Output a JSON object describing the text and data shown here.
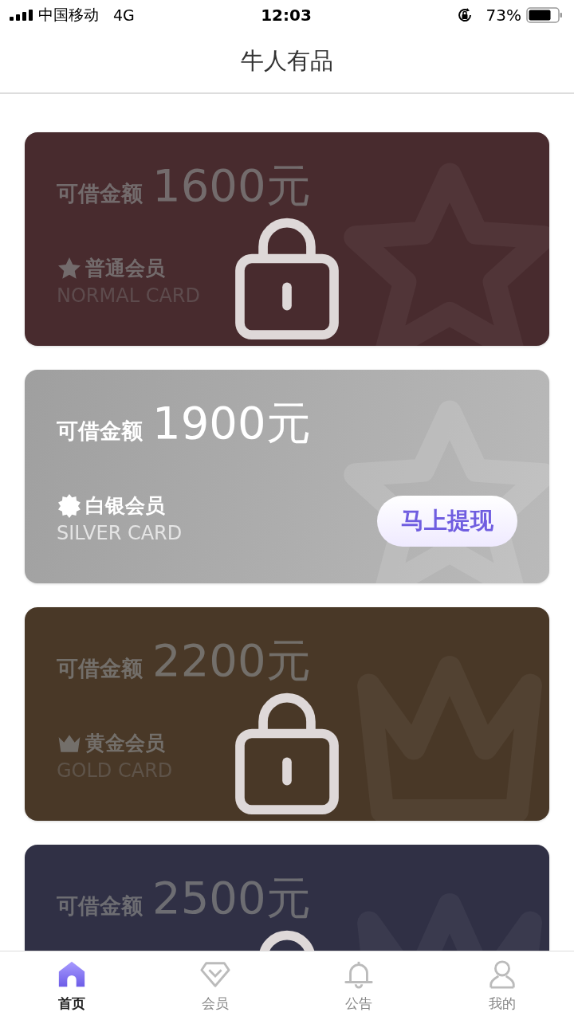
{
  "status_bar": {
    "carrier": "中国移动",
    "network": "4G",
    "time": "12:03",
    "battery": "73%"
  },
  "nav": {
    "title": "牛人有品"
  },
  "cards": [
    {
      "locked": true,
      "color": "#482b2e",
      "kind": "star",
      "label": "可借金额",
      "amount": "1600元",
      "tier": "普通会员",
      "tier_en": "NORMAL CARD"
    },
    {
      "locked": false,
      "color": "#a9a9a9",
      "kind": "burst",
      "label": "可借金额",
      "amount": "1900元",
      "tier": "白银会员",
      "tier_en": "SILVER CARD",
      "button": "马上提现"
    },
    {
      "locked": true,
      "color": "#493827",
      "kind": "crown",
      "label": "可借金额",
      "amount": "2200元",
      "tier": "黄金会员",
      "tier_en": "GOLD CARD"
    },
    {
      "locked": true,
      "color": "#303045",
      "kind": "diamond",
      "label": "可借金额",
      "amount": "2500元"
    }
  ],
  "tabs": [
    {
      "kind": "home",
      "label": "首页",
      "selected": true
    },
    {
      "kind": "member",
      "label": "会员",
      "selected": false
    },
    {
      "kind": "notice",
      "label": "公告",
      "selected": false
    },
    {
      "kind": "profile",
      "label": "我的",
      "selected": false
    }
  ]
}
